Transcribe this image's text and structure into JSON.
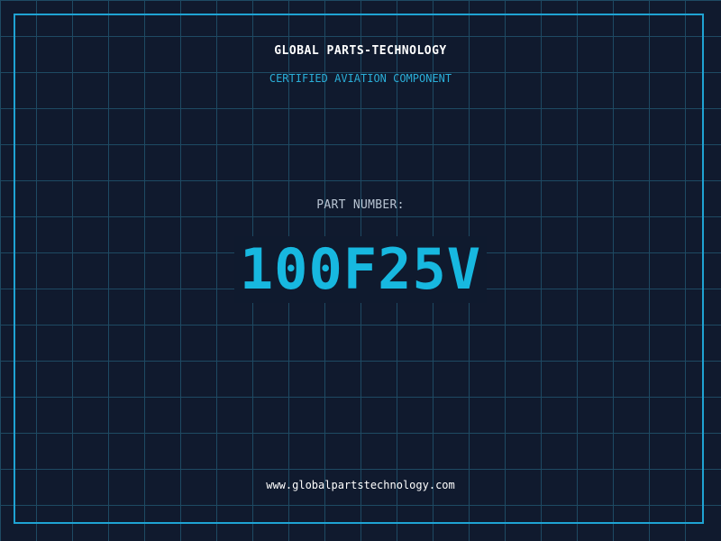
{
  "header": {
    "company": "GLOBAL PARTS-TECHNOLOGY",
    "subtitle": "CERTIFIED AVIATION COMPONENT"
  },
  "part": {
    "label": "PART NUMBER:",
    "number": "100F25V"
  },
  "footer": {
    "website": "www.globalpartstechnology.com"
  },
  "colors": {
    "background": "#101a2e",
    "grid": "#1e4a63",
    "frame": "#1fa3d3",
    "accent": "#17b8e0",
    "subtitle": "#2aaed8"
  }
}
